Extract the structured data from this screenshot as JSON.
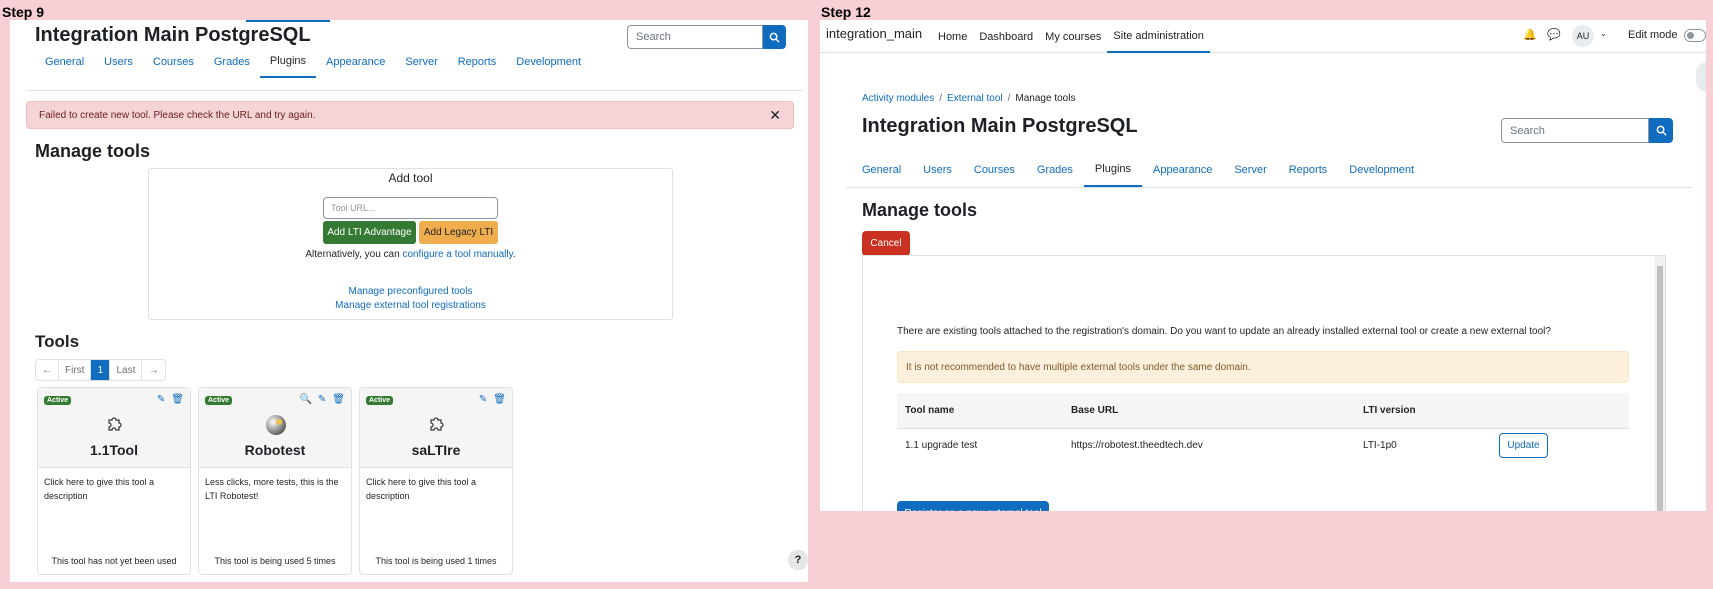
{
  "colors": {
    "primary": "#0f6cbf",
    "danger": "#ca3120",
    "success": "#357a32",
    "warning": "#f0ad4e",
    "background": "#f7cfd5"
  },
  "left": {
    "step_label": "Step 9",
    "site_title": "Integration Main PostgreSQL",
    "search_placeholder": "Search",
    "tabs": [
      "General",
      "Users",
      "Courses",
      "Grades",
      "Plugins",
      "Appearance",
      "Server",
      "Reports",
      "Development"
    ],
    "active_tab": "Plugins",
    "alert": "Failed to create new tool. Please check the URL and try again.",
    "manage_heading": "Manage tools",
    "add_tool": {
      "title": "Add tool",
      "url_placeholder": "Tool URL...",
      "btn_advantage": "Add LTI Advantage",
      "btn_legacy": "Add Legacy LTI",
      "alt_prefix": "Alternatively, you can ",
      "alt_link": "configure a tool manually",
      "alt_suffix": ".",
      "link_preconfigured": "Manage preconfigured tools",
      "link_registrations": "Manage external tool registrations"
    },
    "tools_heading": "Tools",
    "pagination": {
      "first": "First",
      "current": "1",
      "last": "Last"
    },
    "tools": [
      {
        "badge": "Active",
        "name": "1.1Tool",
        "icon": "puzzle-icon",
        "description": "Click here to give this tool a description",
        "usage": "This tool has not yet been used"
      },
      {
        "badge": "Active",
        "name": "Robotest",
        "icon": "globe-icon",
        "description": "Less clicks, more tests, this is the LTI Robotest!",
        "usage": "This tool is being used 5 times"
      },
      {
        "badge": "Active",
        "name": "saLTIre",
        "icon": "puzzle-icon",
        "description": "Click here to give this tool a description",
        "usage": "This tool is being used 1 times"
      }
    ],
    "help_label": "?"
  },
  "right": {
    "step_label": "Step 12",
    "brand": "integration_main",
    "nav": [
      "Home",
      "Dashboard",
      "My courses",
      "Site administration"
    ],
    "active_nav": "Site administration",
    "avatar": "AU",
    "edit_mode": "Edit mode",
    "breadcrumb": [
      "Activity modules",
      "External tool",
      "Manage tools"
    ],
    "site_title": "Integration Main PostgreSQL",
    "search_placeholder": "Search",
    "tabs": [
      "General",
      "Users",
      "Courses",
      "Grades",
      "Plugins",
      "Appearance",
      "Server",
      "Reports",
      "Development"
    ],
    "active_tab": "Plugins",
    "manage_heading": "Manage tools",
    "cancel": "Cancel",
    "question": "There are existing tools attached to the registration's domain. Do you want to update an already installed external tool or create a new external tool?",
    "warning": "It is not recommended to have multiple external tools under the same domain.",
    "table": {
      "headers": [
        "Tool name",
        "Base URL",
        "LTI version"
      ],
      "rows": [
        {
          "name": "1.1 upgrade test",
          "url": "https://robotest.theedtech.dev",
          "version": "LTI-1p0",
          "action": "Update"
        }
      ]
    },
    "register_btn": "Register as a new external tool"
  }
}
